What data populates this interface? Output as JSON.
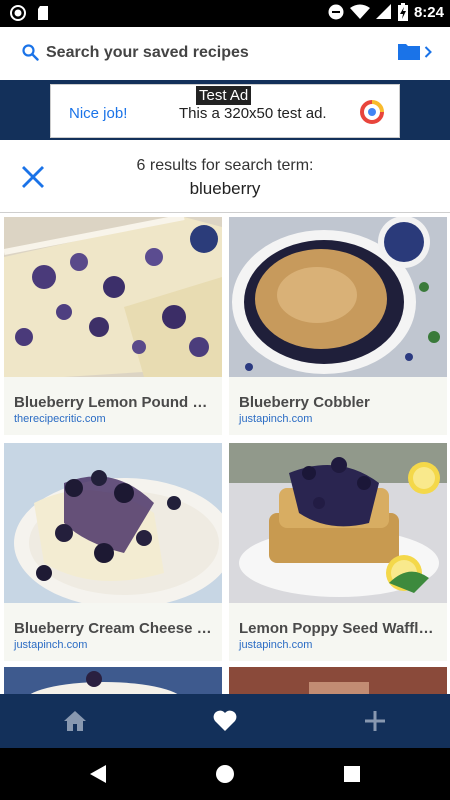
{
  "status_bar": {
    "time": "8:24",
    "icons": [
      "record-icon",
      "sd-card-icon",
      "do-not-disturb-icon",
      "wifi-icon",
      "signal-icon",
      "battery-charging-icon"
    ]
  },
  "search": {
    "placeholder": "Search your saved recipes",
    "icon": "search-icon",
    "folder_icon": "folder-icon"
  },
  "ad": {
    "label": "Test Ad",
    "nice": "Nice job!",
    "text": "This a 320x50 test ad."
  },
  "results": {
    "count_text": "6 results for search term:",
    "term": "blueberry"
  },
  "cards": [
    {
      "title": "Blueberry Lemon Pound C...",
      "source": "therecipecritic.com"
    },
    {
      "title": "Blueberry Cobbler",
      "source": "justapinch.com"
    },
    {
      "title": "Blueberry Cream Cheese F...",
      "source": "justapinch.com"
    },
    {
      "title": "Lemon Poppy Seed Waffle...",
      "source": "justapinch.com"
    }
  ],
  "bottom_nav": {
    "items": [
      "home-icon",
      "heart-icon",
      "add-icon"
    ],
    "active": "heart-icon"
  },
  "colors": {
    "brand_navy": "#13305a",
    "accent_blue": "#1a73e8",
    "link_blue": "#2b6cc4"
  }
}
